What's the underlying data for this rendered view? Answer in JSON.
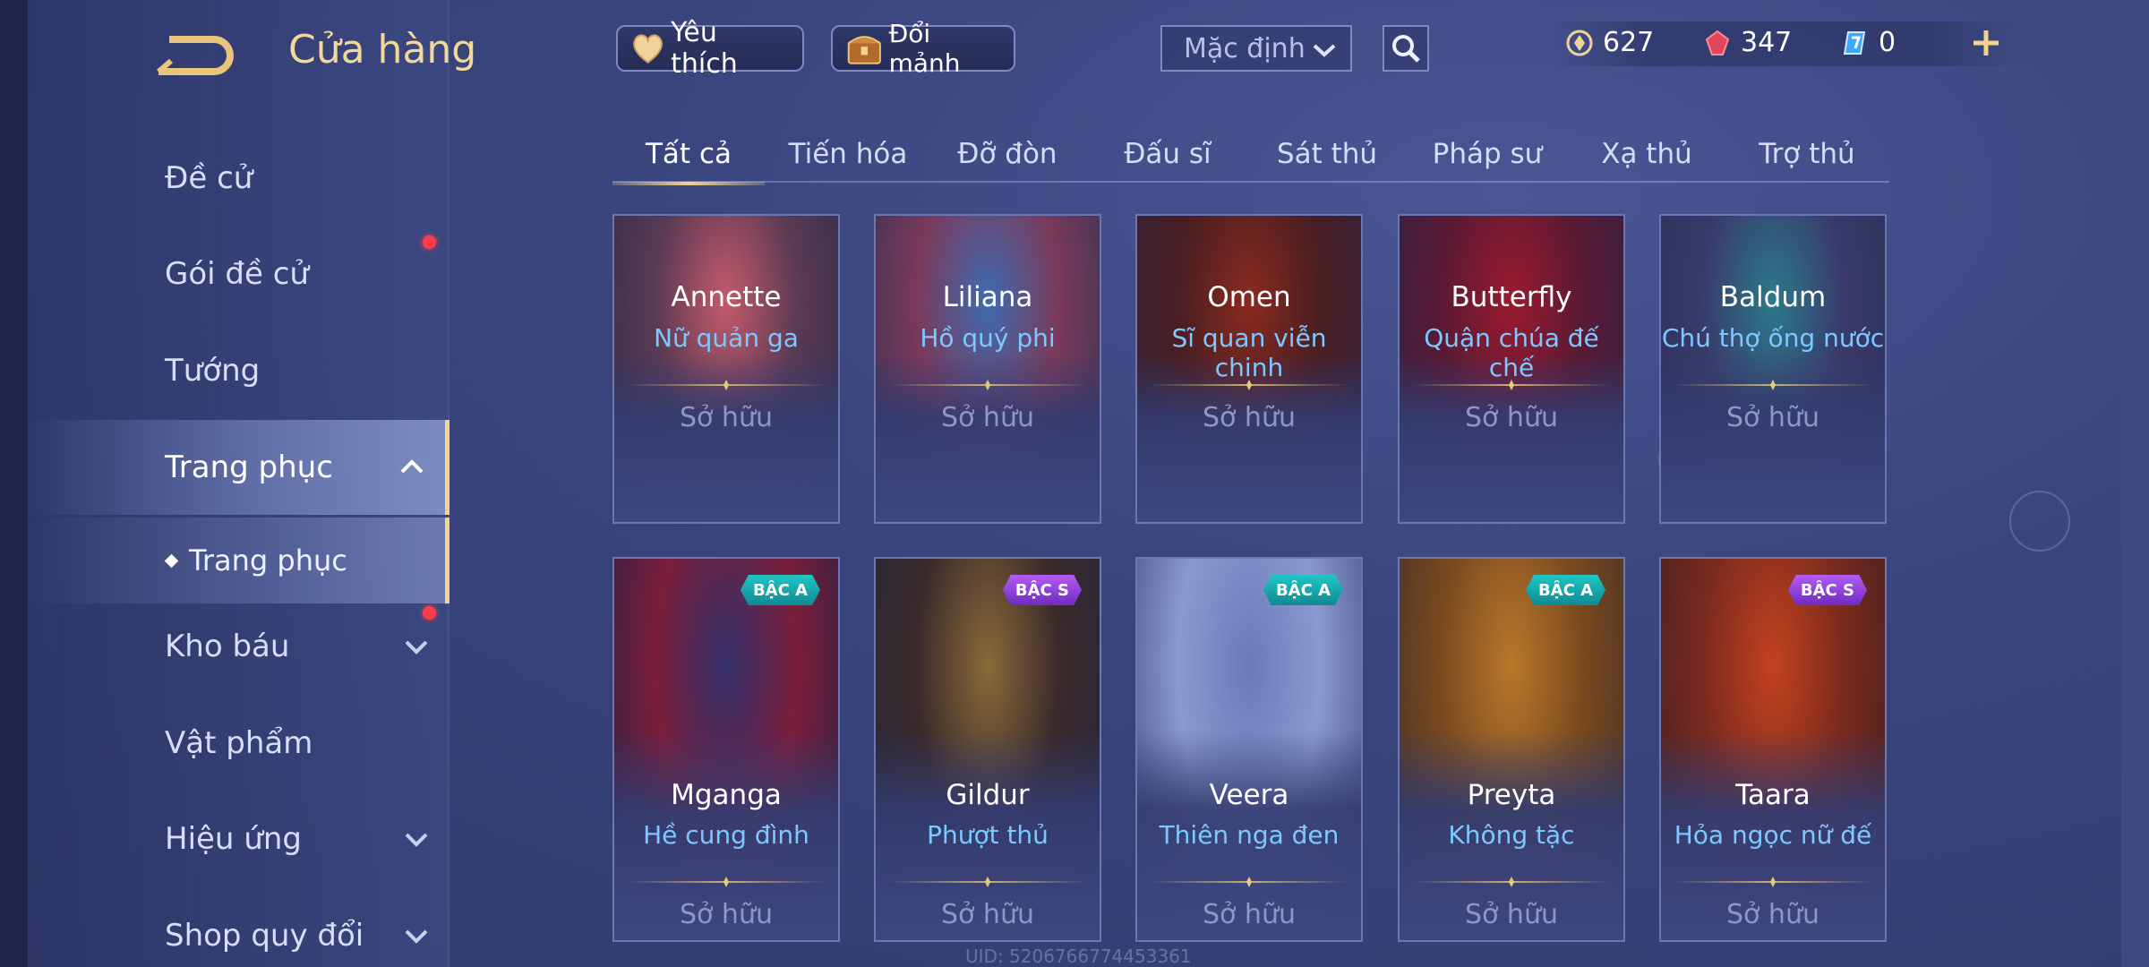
{
  "header": {
    "title": "Cửa hàng"
  },
  "sidebar": {
    "items": [
      {
        "label": "Đề cử"
      },
      {
        "label": "Gói đề cử"
      },
      {
        "label": "Tướng"
      },
      {
        "label": "Trang phục"
      },
      {
        "label": "Kho báu"
      },
      {
        "label": "Vật phẩm"
      },
      {
        "label": "Hiệu ứng"
      },
      {
        "label": "Shop quy đổi"
      }
    ],
    "sub_item": {
      "label": "Trang phục"
    }
  },
  "toolbar": {
    "favorites_label": "Yêu thích",
    "exchange_label": "Đổi mảnh",
    "sort_value": "Mặc định"
  },
  "currency": {
    "gold": "627",
    "gems": "347",
    "vouchers": "0"
  },
  "tabs": [
    {
      "label": "Tất cả"
    },
    {
      "label": "Tiến hóa"
    },
    {
      "label": "Đỡ đòn"
    },
    {
      "label": "Đấu sĩ"
    },
    {
      "label": "Sát thủ"
    },
    {
      "label": "Pháp sư"
    },
    {
      "label": "Xạ thủ"
    },
    {
      "label": "Trợ thủ"
    }
  ],
  "cards": [
    {
      "hero": "Annette",
      "skin": "Nữ quản ga",
      "status": "Sở hữu",
      "badge": ""
    },
    {
      "hero": "Liliana",
      "skin": "Hồ quý phi",
      "status": "Sở hữu",
      "badge": ""
    },
    {
      "hero": "Omen",
      "skin": "Sĩ quan viễn chinh",
      "status": "Sở hữu",
      "badge": ""
    },
    {
      "hero": "Butterfly",
      "skin": "Quận chúa đế chế",
      "status": "Sở hữu",
      "badge": ""
    },
    {
      "hero": "Baldum",
      "skin": "Chú thợ ống nước",
      "status": "Sở hữu",
      "badge": ""
    },
    {
      "hero": "Mganga",
      "skin": "Hề cung đình",
      "status": "Sở hữu",
      "badge": "BẬC A"
    },
    {
      "hero": "Gildur",
      "skin": "Phượt thủ",
      "status": "Sở hữu",
      "badge": "BẬC S"
    },
    {
      "hero": "Veera",
      "skin": "Thiên nga đen",
      "status": "Sở hữu",
      "badge": "BẬC A"
    },
    {
      "hero": "Preyta",
      "skin": "Không tặc",
      "status": "Sở hữu",
      "badge": "BẬC A"
    },
    {
      "hero": "Taara",
      "skin": "Hỏa ngọc nữ đế",
      "status": "Sở hữu",
      "badge": "BẬC S"
    }
  ],
  "footer": {
    "uid": "UID: 5206766774453361"
  },
  "colors": {
    "accent_gold": "#f3d48d",
    "skin_name_blue": "#7cc8ff",
    "badge_a": "#1fc7c4",
    "badge_s": "#b45cf5",
    "notification_red": "#ff3b4a"
  }
}
